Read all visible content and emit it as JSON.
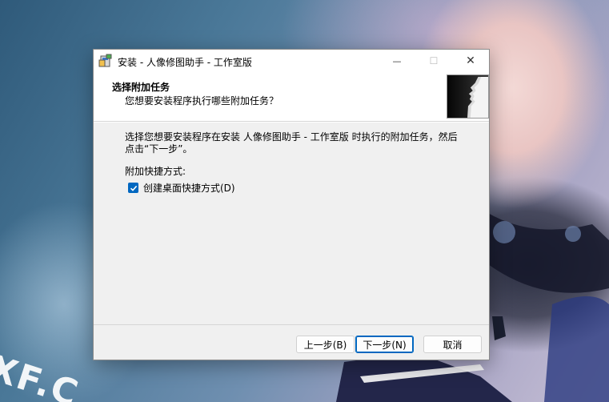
{
  "wallpaper_text": "XF.C",
  "dialog": {
    "title": "安装 - 人像修图助手 - 工作室版",
    "window_controls": {
      "minimize": "—",
      "maximize": "☐",
      "close": "✕"
    },
    "header": {
      "title": "选择附加任务",
      "subtitle": "您想要安装程序执行哪些附加任务？"
    },
    "content": {
      "description": "选择您想要安装程序在安装 人像修图助手 - 工作室版 时执行的附加任务，然后点击“下一步”。",
      "shortcuts_label": "附加快捷方式:",
      "desktop_shortcut": {
        "label": "创建桌面快捷方式(D)",
        "checked": true
      }
    },
    "buttons": {
      "back": "上一步(B)",
      "next": "下一步(N)",
      "cancel": "取消"
    }
  },
  "colors": {
    "accent": "#0067c0",
    "dialog_bg": "#f0f0f0",
    "header_bg": "#ffffff"
  }
}
